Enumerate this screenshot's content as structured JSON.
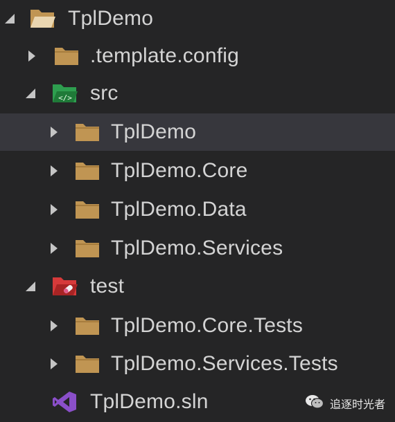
{
  "explorer": {
    "items": [
      {
        "label": "TplDemo",
        "kind": "folder-open",
        "expanded": true
      },
      {
        "label": ".template.config",
        "kind": "folder",
        "expanded": false
      },
      {
        "label": "src",
        "kind": "folder-src",
        "expanded": true
      },
      {
        "label": "TplDemo",
        "kind": "folder",
        "expanded": false,
        "selected": true
      },
      {
        "label": "TplDemo.Core",
        "kind": "folder",
        "expanded": false
      },
      {
        "label": "TplDemo.Data",
        "kind": "folder",
        "expanded": false
      },
      {
        "label": "TplDemo.Services",
        "kind": "folder",
        "expanded": false
      },
      {
        "label": "test",
        "kind": "folder-test",
        "expanded": true
      },
      {
        "label": "TplDemo.Core.Tests",
        "kind": "folder",
        "expanded": false
      },
      {
        "label": "TplDemo.Services.Tests",
        "kind": "folder",
        "expanded": false
      },
      {
        "label": "TplDemo.sln",
        "kind": "solution-file"
      }
    ]
  },
  "watermark": {
    "text": "追逐时光者",
    "icon": "wechat-icon"
  },
  "colors": {
    "background": "#252526",
    "selection": "#37373d",
    "folder": "#c09553",
    "src_folder": "#2e9e4f",
    "test_folder": "#d63a3a",
    "solution_icon": "#8a4fc9",
    "text": "#d4d4d4"
  }
}
